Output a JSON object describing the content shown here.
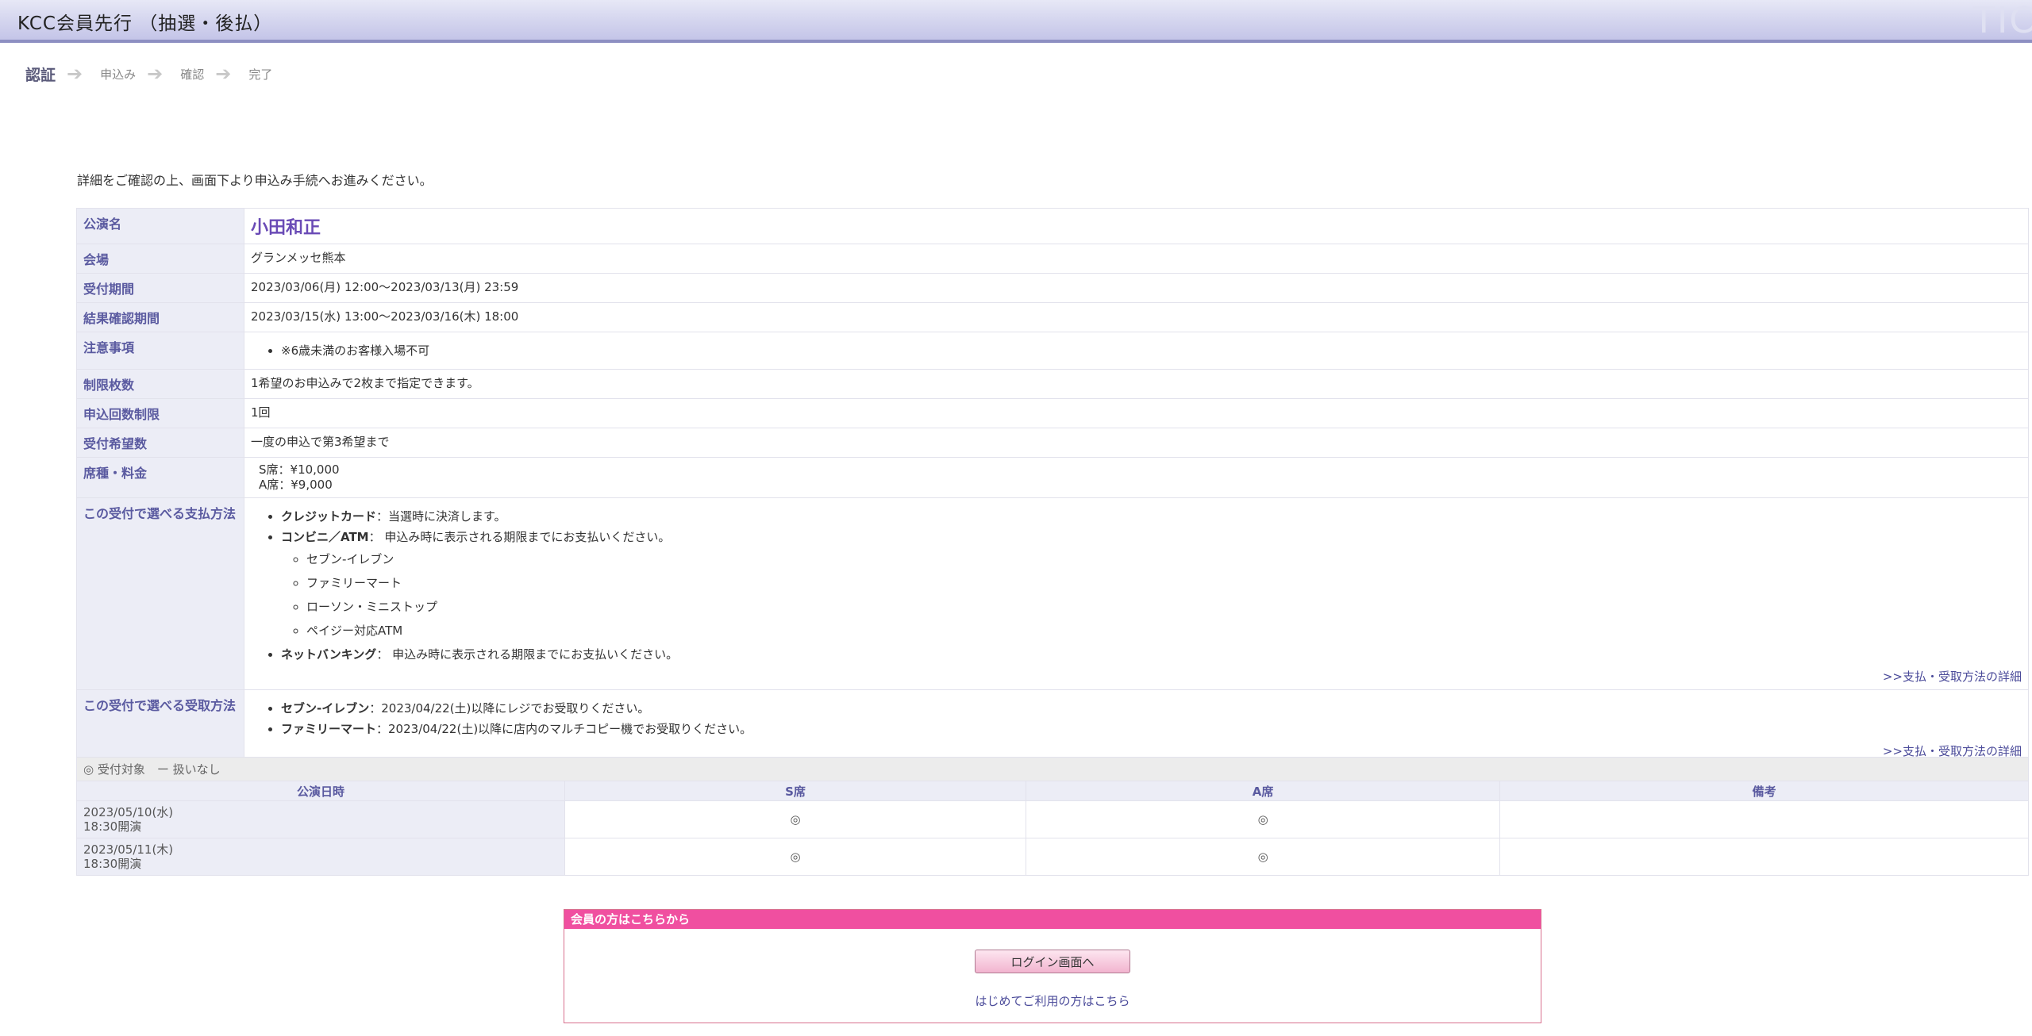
{
  "header": {
    "title": "KCC会員先行 （抽選・後払）",
    "logo_text": "TIC"
  },
  "steps": [
    "認証",
    "申込み",
    "確認",
    "完了"
  ],
  "intro": "詳細をご確認の上、画面下より申込み手続へお進みください。",
  "details": {
    "perf_label": "公演名",
    "perf_name": "小田和正",
    "venue_label": "会場",
    "venue": "グランメッセ熊本",
    "accept_label": "受付期間",
    "accept": "2023/03/06(月) 12:00～2023/03/13(月) 23:59",
    "result_label": "結果確認期間",
    "result": "2023/03/15(水) 13:00～2023/03/16(木) 18:00",
    "notes_label": "注意事項",
    "note1": "※6歳未満のお客様入場不可",
    "limit_label": "制限枚数",
    "limit": "1希望のお申込みで2枚まで指定できます。",
    "times_label": "申込回数制限",
    "times": "1回",
    "wishes_label": "受付希望数",
    "wishes": "一度の申込で第3希望まで",
    "seat_label": "席種・料金",
    "seat_s": "S席：¥10,000",
    "seat_a": "A席：¥9,000",
    "payment_label": "この受付で選べる支払方法",
    "pay_credit_name": "クレジットカード",
    "pay_credit_desc": "：当選時に決済します。",
    "pay_conv_name": "コンビニ／ATM",
    "pay_conv_desc": "： 申込み時に表示される期限までにお支払いください。",
    "stores": [
      "セブン-イレブン",
      "ファミリーマート",
      "ローソン・ミニストップ",
      "ペイジー対応ATM"
    ],
    "pay_net_name": "ネットバンキング",
    "pay_net_desc": "： 申込み時に表示される期限までにお支払いください。",
    "detail_link": ">>支払・受取方法の詳細",
    "receive_label": "この受付で選べる受取方法",
    "recv_seven_name": "セブン-イレブン",
    "recv_seven_desc": "：2023/04/22(土)以降にレジでお受取りください。",
    "recv_family_name": "ファミリーマート",
    "recv_family_desc": "：2023/04/22(土)以降に店内のマルチコピー機でお受取りください。"
  },
  "schedule": {
    "legend": "◎ 受付対象　ー 扱いなし",
    "columns": [
      "公演日時",
      "S席",
      "A席",
      "備考"
    ],
    "rows": [
      {
        "date": "2023/05/10(水)",
        "time": "18:30開演",
        "s": "◎",
        "a": "◎",
        "note": ""
      },
      {
        "date": "2023/05/11(木)",
        "time": "18:30開演",
        "s": "◎",
        "a": "◎",
        "note": ""
      }
    ]
  },
  "login": {
    "header": "会員の方はこちらから",
    "button": "ログイン画面へ",
    "first_time": "はじめてご利用の方はこちら"
  }
}
